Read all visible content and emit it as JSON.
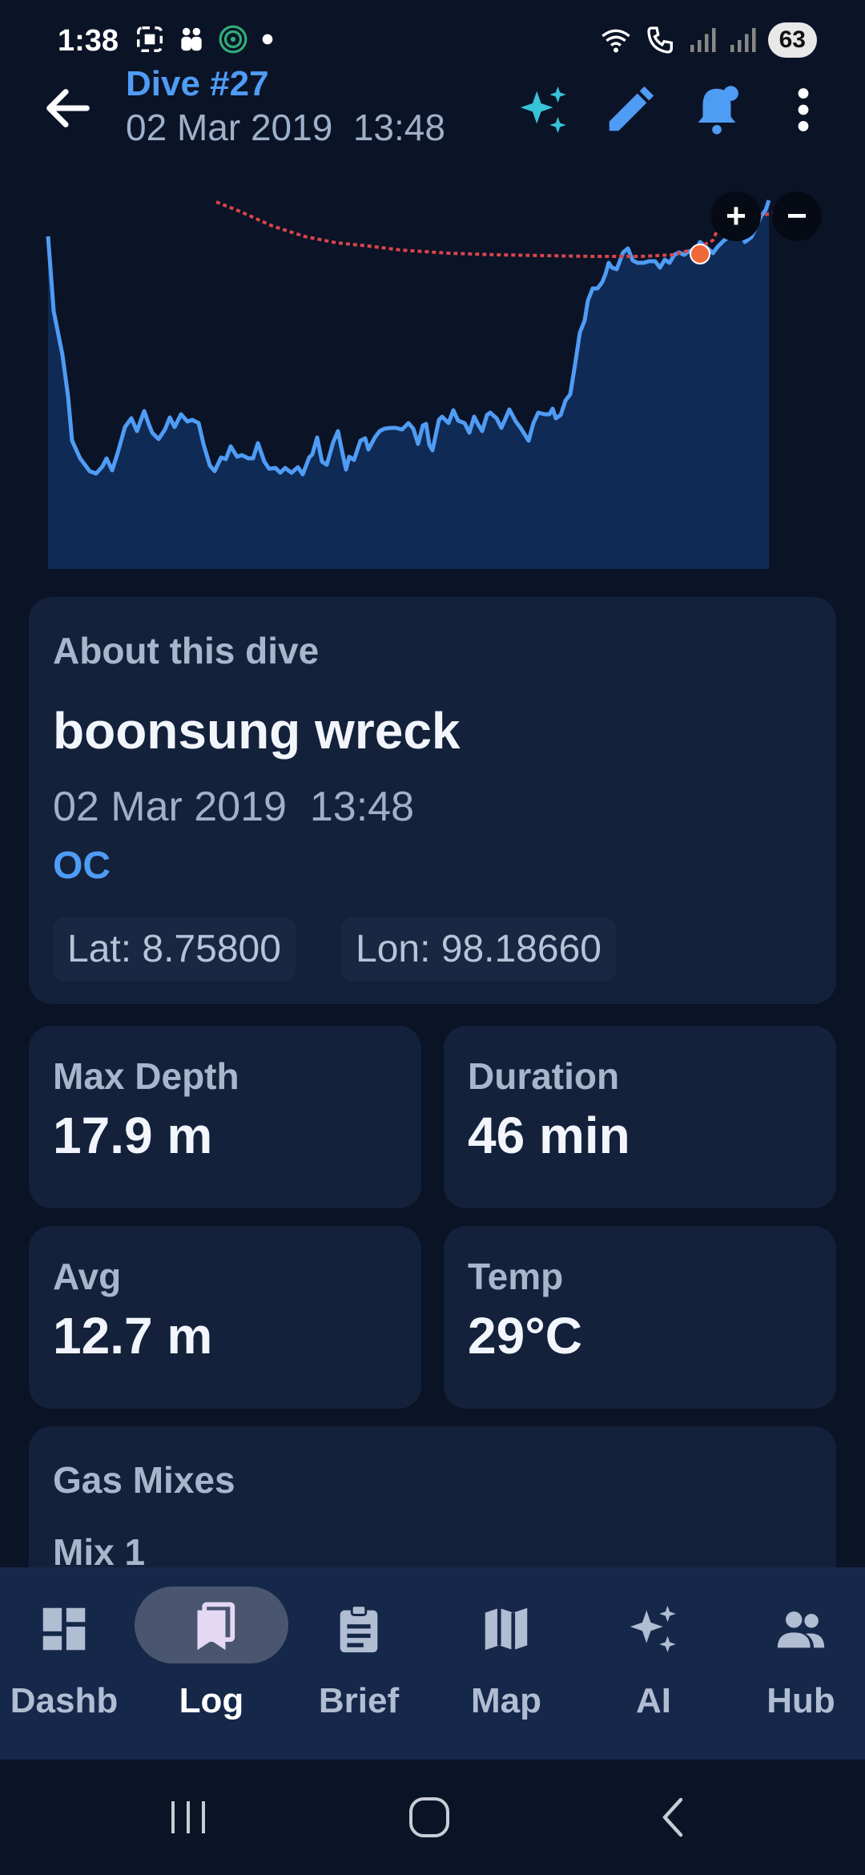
{
  "status_bar": {
    "time": "1:38",
    "battery": "63"
  },
  "header": {
    "title": "Dive #27",
    "subtitle": "02 Mar 2019  13:48"
  },
  "profile_chart": {
    "zoom_in": "+",
    "zoom_out": "−"
  },
  "about": {
    "label": "About this dive",
    "site": "boonsung wreck",
    "datetime": "02 Mar 2019  13:48",
    "mode": "OC",
    "lat": "Lat: 8.75800",
    "lon": "Lon: 98.18660"
  },
  "stats": {
    "max_depth": {
      "label": "Max Depth",
      "value": "17.9 m"
    },
    "duration": {
      "label": "Duration",
      "value": "46 min"
    },
    "avg": {
      "label": "Avg",
      "value": "12.7 m"
    },
    "temp": {
      "label": "Temp",
      "value": "29°C"
    }
  },
  "gas": {
    "label": "Gas Mixes",
    "mix": "Mix 1"
  },
  "nav": {
    "items": [
      {
        "label": "Dashb",
        "icon": "dashboard-icon"
      },
      {
        "label": "Log",
        "icon": "log-icon"
      },
      {
        "label": "Brief",
        "icon": "clipboard-icon"
      },
      {
        "label": "Map",
        "icon": "map-icon"
      },
      {
        "label": "AI",
        "icon": "sparkle-icon"
      },
      {
        "label": "Hub",
        "icon": "people-icon"
      }
    ],
    "active": "Log"
  },
  "colors": {
    "accent": "#4f9cf5",
    "background": "#0b1326",
    "card": "#13213b",
    "profile_line": "#4f9cf5",
    "ceiling_line": "#d9454b",
    "marker": "#f0673a"
  }
}
